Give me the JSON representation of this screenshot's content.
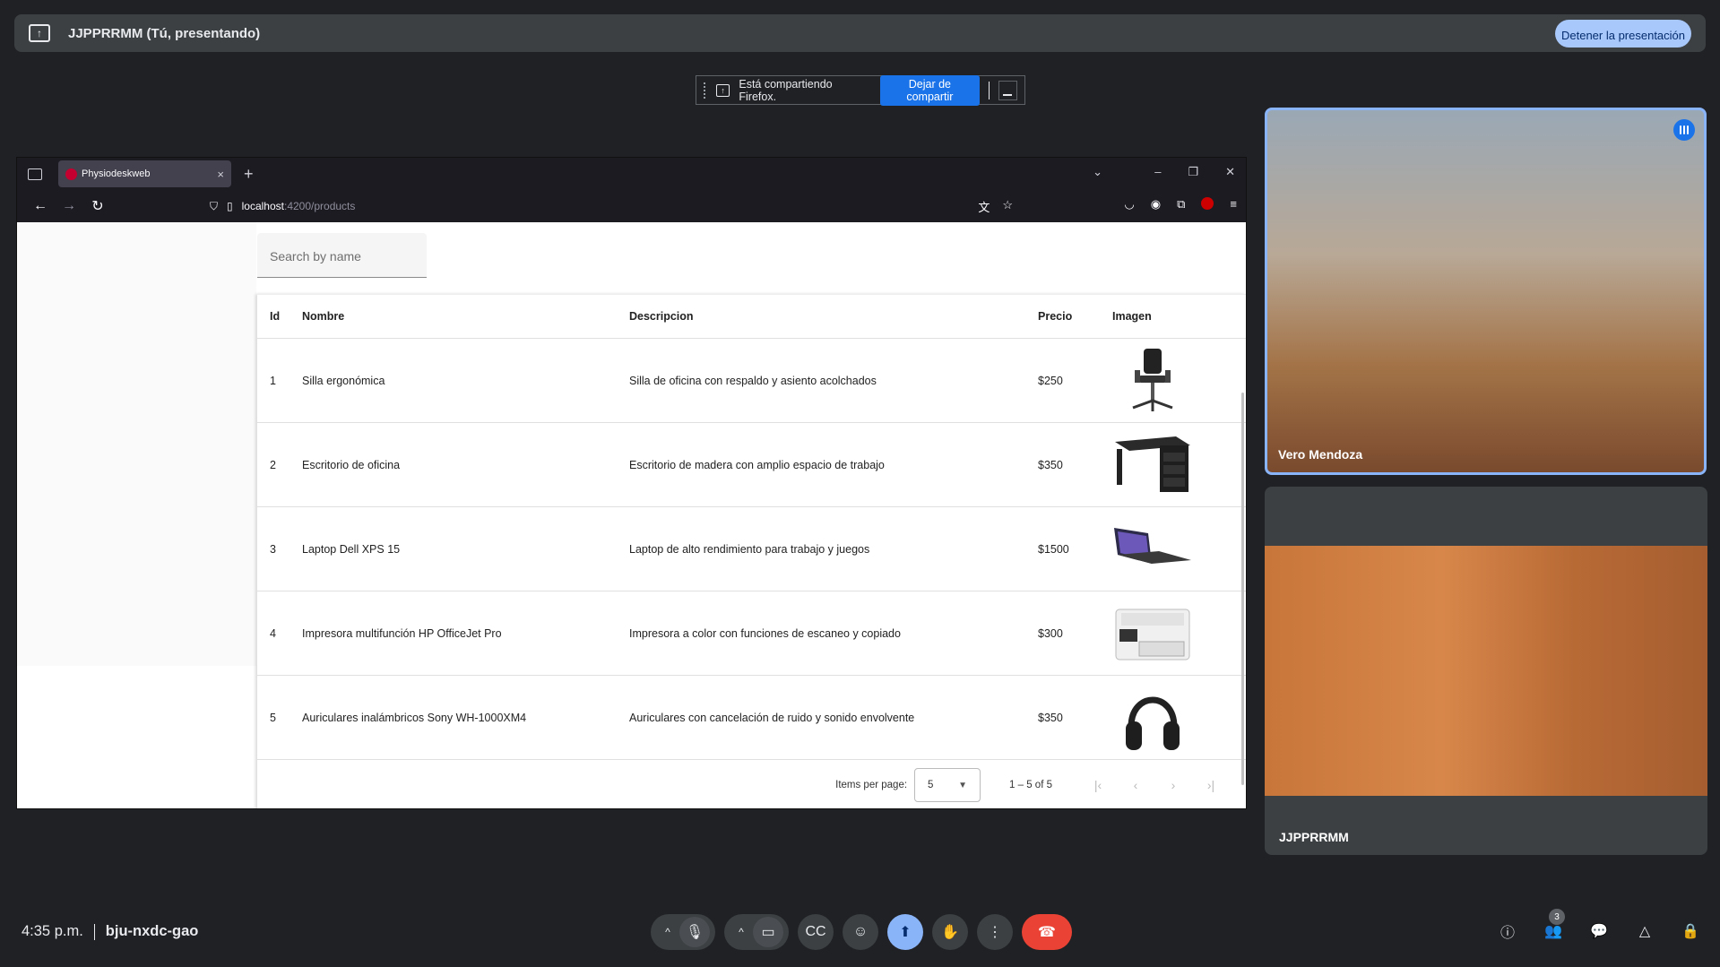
{
  "present_bar": {
    "title": "JJPPRRMM (Tú, presentando)",
    "stop_button": "Detener la presentación"
  },
  "share_notice": {
    "text": "Está compartiendo Firefox.",
    "stop_sharing": "Dejar de compartir"
  },
  "browser": {
    "tab_title": "Physiodeskweb",
    "url_host": "localhost",
    "url_path": ":4200/products"
  },
  "app": {
    "search_placeholder": "Search by name",
    "columns": [
      "Id",
      "Nombre",
      "Descripcion",
      "Precio",
      "Imagen"
    ],
    "rows": [
      {
        "id": "1",
        "nombre": "Silla ergonómica",
        "descripcion": "Silla de oficina con respaldo y asiento acolchados",
        "precio": "$250",
        "image": "office-chair"
      },
      {
        "id": "2",
        "nombre": "Escritorio de oficina",
        "descripcion": "Escritorio de madera con amplio espacio de trabajo",
        "precio": "$350",
        "image": "office-desk"
      },
      {
        "id": "3",
        "nombre": "Laptop Dell XPS 15",
        "descripcion": "Laptop de alto rendimiento para trabajo y juegos",
        "precio": "$1500",
        "image": "laptop"
      },
      {
        "id": "4",
        "nombre": "Impresora multifunción HP OfficeJet Pro",
        "descripcion": "Impresora a color con funciones de escaneo y copiado",
        "precio": "$300",
        "image": "printer"
      },
      {
        "id": "5",
        "nombre": "Auriculares inalámbricos Sony WH-1000XM4",
        "descripcion": "Auriculares con cancelación de ruido y sonido envolvente",
        "precio": "$350",
        "image": "headphones"
      }
    ],
    "paginator": {
      "items_per_page_label": "Items per page:",
      "page_size": "5",
      "range": "1 – 5 of 5"
    }
  },
  "participants": [
    {
      "name": "Vero Mendoza",
      "speaking": true
    },
    {
      "name": "JJPPRRMM",
      "speaking": false
    }
  ],
  "meeting": {
    "time": "4:35 p.m.",
    "code": "bju-nxdc-gao",
    "people_count": "3"
  },
  "colors": {
    "accent": "#8ab4f8",
    "end_call": "#ea4335",
    "background": "#202124"
  }
}
